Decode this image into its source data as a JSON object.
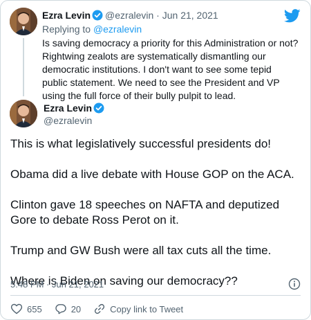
{
  "reply": {
    "author_name": "Ezra Levin",
    "author_handle": "@ezralevin",
    "separator": "·",
    "date": "Jun 21, 2021",
    "replying_prefix": "Replying to",
    "replying_handle": "@ezralevin",
    "text": "Is saving democracy a priority for this Administration or not? Rightwing zealots are systematically dismantling our democratic institutions. I don't want to see some tepid public statement. We need to see the President and VP using the full force of their bully pulpit to lead."
  },
  "tweet": {
    "author_name": "Ezra Levin",
    "author_handle": "@ezralevin",
    "paragraphs": [
      "This is what legislatively successful presidents do!",
      "Obama did a live debate with House GOP on the ACA.",
      "Clinton gave 18 speeches on NAFTA and deputized Gore to debate Ross Perot on it.",
      "Trump and GW Bush were all tax cuts all the time.",
      "Where is Biden on saving our democracy??"
    ],
    "timestamp": "5:48 PM · Jun 21, 2021"
  },
  "actions": {
    "likes": "655",
    "replies": "20",
    "copy_link": "Copy link to Tweet"
  },
  "icons": {
    "brand": "twitter-bird-icon",
    "verified": "verified-badge-icon",
    "info": "info-icon",
    "like": "heart-icon",
    "reply": "reply-icon",
    "link": "link-icon"
  },
  "colors": {
    "accent": "#1d9bf0",
    "text": "#0f1419",
    "muted": "#536471",
    "border": "#cfd9de"
  }
}
